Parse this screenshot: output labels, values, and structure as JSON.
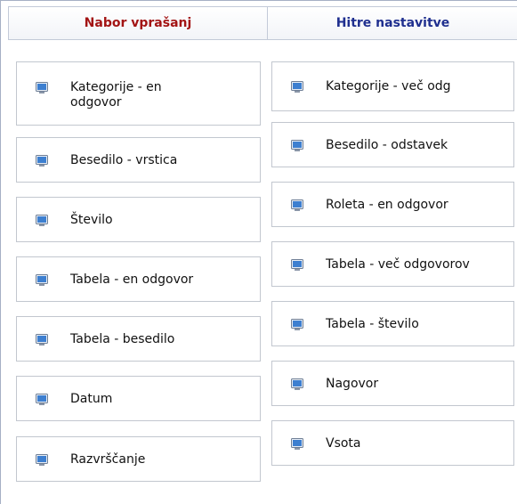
{
  "tabs": {
    "left": "Nabor vprašanj",
    "right": "Hitre nastavitve"
  },
  "left_items": [
    {
      "label_line1": "Kategorije - en",
      "label_line2": "odgovor"
    },
    {
      "label": "Besedilo - vrstica"
    },
    {
      "label": "Število"
    },
    {
      "label": "Tabela - en odgovor"
    },
    {
      "label": "Tabela - besedilo"
    },
    {
      "label": "Datum"
    },
    {
      "label": "Razvrščanje"
    }
  ],
  "right_items": [
    {
      "label": "Kategorije - več odg"
    },
    {
      "label": "Besedilo - odstavek"
    },
    {
      "label": "Roleta - en odgovor"
    },
    {
      "label": "Tabela - več odgovorov"
    },
    {
      "label": "Tabela - število"
    },
    {
      "label": "Nagovor"
    },
    {
      "label": "Vsota"
    }
  ],
  "icon": "monitor-icon",
  "colors": {
    "left_tab": "#a31414",
    "right_tab": "#1f2f8f",
    "icon_screen": "#3d7fd0"
  }
}
